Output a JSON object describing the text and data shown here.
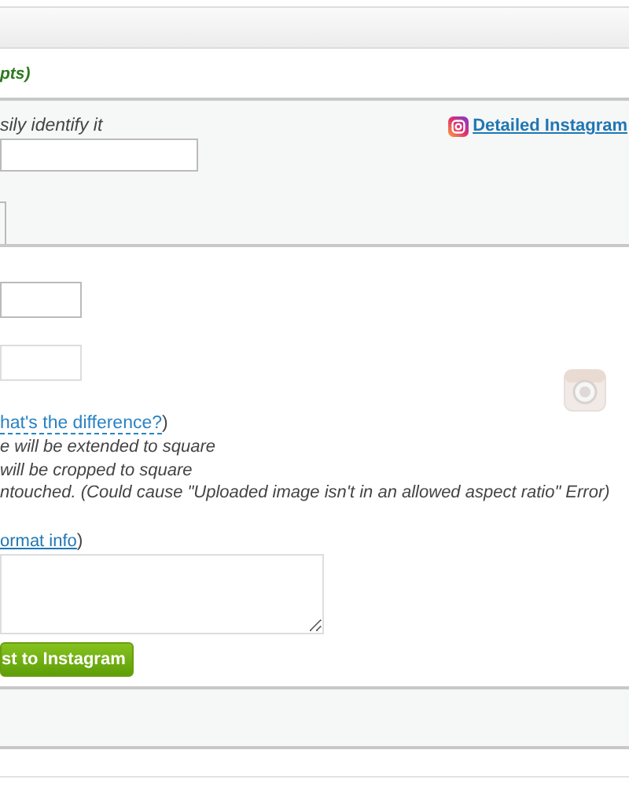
{
  "section_title": "pts)",
  "settings_panel": {
    "hint": "sily identify it",
    "link": "Detailed Instagram"
  },
  "crop_options": {
    "help_link": "hat's the difference?",
    "help_suffix": ")",
    "choices": [
      "e will be extended to square",
      "will be cropped to square",
      "ntouched. (Could cause \"Uploaded image isn't in an allowed aspect ratio\" Error)"
    ]
  },
  "caption": {
    "info_link": "ormat info",
    "info_suffix": ")"
  },
  "submit_button": "st to Instagram"
}
